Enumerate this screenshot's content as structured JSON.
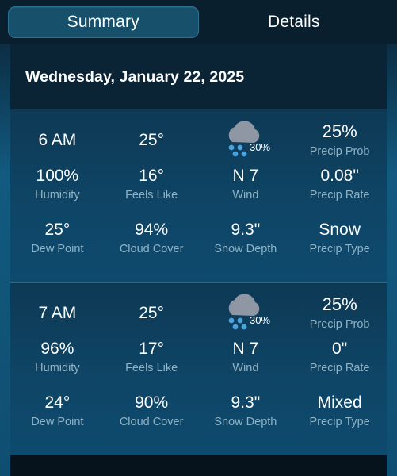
{
  "tabs": [
    {
      "label": "Summary",
      "selected": true
    },
    {
      "label": "Details",
      "selected": false
    }
  ],
  "date_header": {
    "date": "Wednesday, January 22, 2025"
  },
  "colors": {
    "page_background": "#06131d",
    "tabbar_background": "#0a1f2d",
    "tab_selected_background": "#16506b",
    "date_header_background": "#0a2436",
    "hour_block_background": "#0f4566",
    "rail": "#125a80",
    "value_text": "#ffffff",
    "label_text": "#8fb3c6",
    "cloud_grey": "#8e97a3",
    "snowflake_blue": "#4da3dd"
  },
  "hours": [
    {
      "time": "6 AM",
      "temperature": "25°",
      "icon": {
        "name": "snow-cloud-icon",
        "badge": "30%"
      },
      "precip_prob": {
        "value": "25%",
        "label": "Precip Prob"
      },
      "humidity": {
        "value": "100%",
        "label": "Humidity"
      },
      "feels_like": {
        "value": "16°",
        "label": "Feels Like"
      },
      "wind": {
        "value": "N 7",
        "label": "Wind"
      },
      "precip_rate": {
        "value": "0.08\"",
        "label": "Precip Rate"
      },
      "dew_point": {
        "value": "25°",
        "label": "Dew Point"
      },
      "cloud_cover": {
        "value": "94%",
        "label": "Cloud Cover"
      },
      "snow_depth": {
        "value": "9.3\"",
        "label": "Snow Depth"
      },
      "precip_type": {
        "value": "Snow",
        "label": "Precip Type"
      }
    },
    {
      "time": "7 AM",
      "temperature": "25°",
      "icon": {
        "name": "snow-cloud-icon",
        "badge": "30%"
      },
      "precip_prob": {
        "value": "25%",
        "label": "Precip Prob"
      },
      "humidity": {
        "value": "96%",
        "label": "Humidity"
      },
      "feels_like": {
        "value": "17°",
        "label": "Feels Like"
      },
      "wind": {
        "value": "N 7",
        "label": "Wind"
      },
      "precip_rate": {
        "value": "0\"",
        "label": "Precip Rate"
      },
      "dew_point": {
        "value": "24°",
        "label": "Dew Point"
      },
      "cloud_cover": {
        "value": "90%",
        "label": "Cloud Cover"
      },
      "snow_depth": {
        "value": "9.3\"",
        "label": "Snow Depth"
      },
      "precip_type": {
        "value": "Mixed",
        "label": "Precip Type"
      }
    }
  ]
}
